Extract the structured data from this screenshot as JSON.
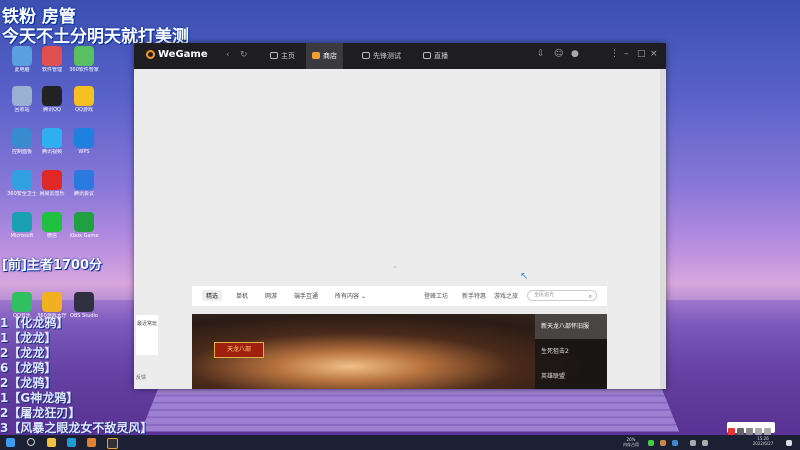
{
  "overlay": {
    "title": "铁粉 房管",
    "subtitle": "今天不土分明天就打美测",
    "counter": "[前]主者1700分",
    "ranks": [
      "1【化龙鸦】",
      "1【龙龙】",
      "2【龙龙】",
      "6【龙鸦】",
      "2【龙鸦】",
      "1【G神龙鸦】",
      "2【屠龙狂刃】",
      "3【风暴之眼龙女不敌灵风】"
    ]
  },
  "desktop_icons": [
    {
      "label": "此电脑",
      "color": "#5aa0e0"
    },
    {
      "label": "软件管理",
      "color": "#e05050"
    },
    {
      "label": "360软件管家",
      "color": "#58c060"
    },
    {
      "label": "回收站",
      "color": "#9ab0d0"
    },
    {
      "label": "腾讯QQ",
      "color": "#222222"
    },
    {
      "label": "QQ游戏",
      "color": "#f5c020"
    },
    {
      "label": "控制面板",
      "color": "#3a8ad0"
    },
    {
      "label": "腾讯视频",
      "color": "#30b0f0"
    },
    {
      "label": "WPS",
      "color": "#2080e0"
    },
    {
      "label": "360安全卫士",
      "color": "#30a0e0"
    },
    {
      "label": "网易云音乐",
      "color": "#e02828"
    },
    {
      "label": "腾讯会议",
      "color": "#2a7ae0"
    },
    {
      "label": "Microsoft Edge",
      "color": "#1aa0b0"
    },
    {
      "label": "微信",
      "color": "#20c040"
    },
    {
      "label": "Xbox Game",
      "color": "#20a040"
    },
    {
      "label": "QQ音乐",
      "color": "#30c060"
    },
    {
      "label": "360游戏大厅",
      "color": "#f0b020"
    },
    {
      "label": "OBS Studio",
      "color": "#303040"
    }
  ],
  "window": {
    "logo": "WeGame",
    "tabs": [
      {
        "label": "主页",
        "active": false
      },
      {
        "label": "商店",
        "active": true
      },
      {
        "label": "先锋测试",
        "active": false
      },
      {
        "label": "直播",
        "active": false
      }
    ],
    "store_tabs": [
      "精选",
      "单机",
      "网游",
      "端手互通",
      "所有内容"
    ],
    "store_links": [
      "登峰工坊",
      "新手特惠",
      "游戏之旅"
    ],
    "search_placeholder": "全民追光",
    "side_card": "最近常玩",
    "feedback": "反馈",
    "banner_logo": "天龙八部",
    "banner_list": [
      "新天龙八部怀旧服",
      "生死狙击2",
      "英雄联盟"
    ]
  },
  "taskbar": {
    "cpu": "26%",
    "cpu_label": "内存占用",
    "time": "15:26",
    "date": "2022/6/27"
  }
}
